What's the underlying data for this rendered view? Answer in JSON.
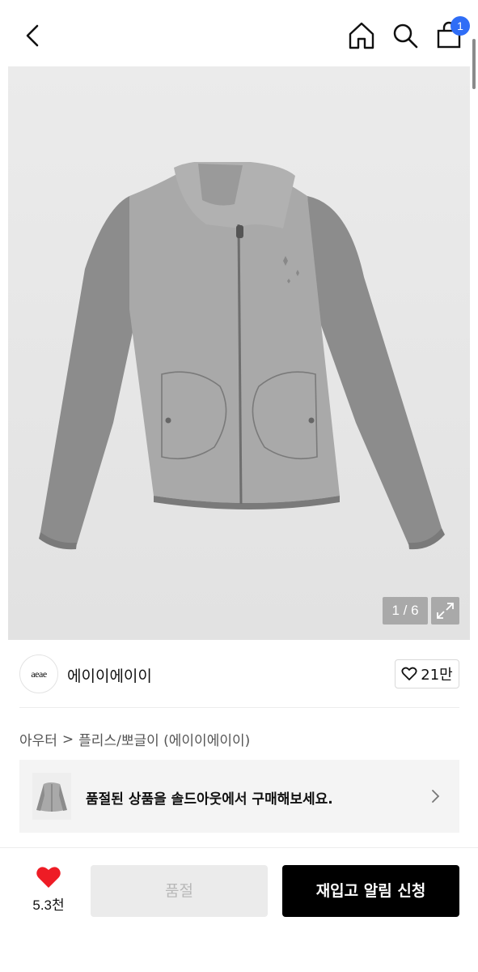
{
  "header": {
    "cart_count": "1",
    "icons": [
      "back-icon",
      "home-icon",
      "search-icon",
      "cart-bag-icon"
    ]
  },
  "gallery": {
    "counter": "1 / 6",
    "colors": {
      "body": "#a9a9a9",
      "sleeve": "#8c8c8c",
      "trim": "#7a7a7a"
    }
  },
  "brand": {
    "logo_text": "aeae",
    "name": "에이이에이이",
    "likes": "21만"
  },
  "breadcrumb": {
    "category": "아우터",
    "separator": ">",
    "subcategory": "플리스/뽀글이 (에이이에이이)"
  },
  "soldout_notice": {
    "text": "품절된 상품을 솔드아웃에서 구매해보세요."
  },
  "bottom_bar": {
    "wish_count": "5.3천",
    "soldout_label": "품절",
    "restock_label": "재입고 알림 신청"
  }
}
